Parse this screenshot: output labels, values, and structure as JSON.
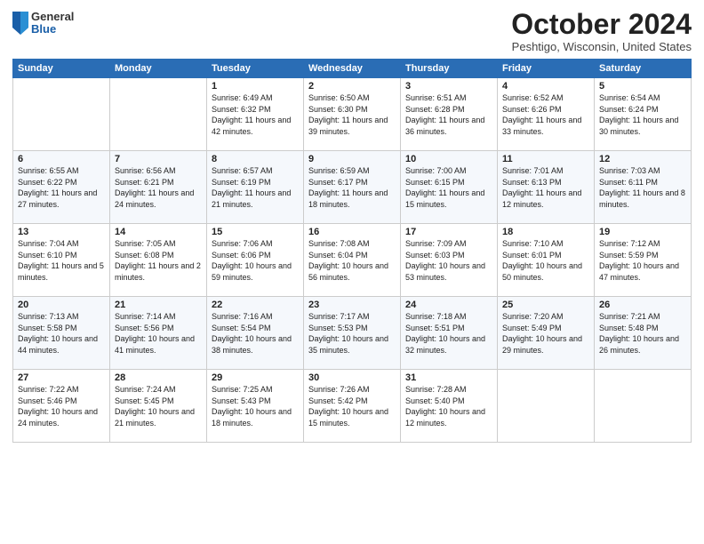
{
  "header": {
    "logo_general": "General",
    "logo_blue": "Blue",
    "month": "October 2024",
    "location": "Peshtigo, Wisconsin, United States"
  },
  "days_of_week": [
    "Sunday",
    "Monday",
    "Tuesday",
    "Wednesday",
    "Thursday",
    "Friday",
    "Saturday"
  ],
  "weeks": [
    [
      {
        "day": "",
        "info": ""
      },
      {
        "day": "",
        "info": ""
      },
      {
        "day": "1",
        "info": "Sunrise: 6:49 AM\nSunset: 6:32 PM\nDaylight: 11 hours\nand 42 minutes."
      },
      {
        "day": "2",
        "info": "Sunrise: 6:50 AM\nSunset: 6:30 PM\nDaylight: 11 hours\nand 39 minutes."
      },
      {
        "day": "3",
        "info": "Sunrise: 6:51 AM\nSunset: 6:28 PM\nDaylight: 11 hours\nand 36 minutes."
      },
      {
        "day": "4",
        "info": "Sunrise: 6:52 AM\nSunset: 6:26 PM\nDaylight: 11 hours\nand 33 minutes."
      },
      {
        "day": "5",
        "info": "Sunrise: 6:54 AM\nSunset: 6:24 PM\nDaylight: 11 hours\nand 30 minutes."
      }
    ],
    [
      {
        "day": "6",
        "info": "Sunrise: 6:55 AM\nSunset: 6:22 PM\nDaylight: 11 hours\nand 27 minutes."
      },
      {
        "day": "7",
        "info": "Sunrise: 6:56 AM\nSunset: 6:21 PM\nDaylight: 11 hours\nand 24 minutes."
      },
      {
        "day": "8",
        "info": "Sunrise: 6:57 AM\nSunset: 6:19 PM\nDaylight: 11 hours\nand 21 minutes."
      },
      {
        "day": "9",
        "info": "Sunrise: 6:59 AM\nSunset: 6:17 PM\nDaylight: 11 hours\nand 18 minutes."
      },
      {
        "day": "10",
        "info": "Sunrise: 7:00 AM\nSunset: 6:15 PM\nDaylight: 11 hours\nand 15 minutes."
      },
      {
        "day": "11",
        "info": "Sunrise: 7:01 AM\nSunset: 6:13 PM\nDaylight: 11 hours\nand 12 minutes."
      },
      {
        "day": "12",
        "info": "Sunrise: 7:03 AM\nSunset: 6:11 PM\nDaylight: 11 hours\nand 8 minutes."
      }
    ],
    [
      {
        "day": "13",
        "info": "Sunrise: 7:04 AM\nSunset: 6:10 PM\nDaylight: 11 hours\nand 5 minutes."
      },
      {
        "day": "14",
        "info": "Sunrise: 7:05 AM\nSunset: 6:08 PM\nDaylight: 11 hours\nand 2 minutes."
      },
      {
        "day": "15",
        "info": "Sunrise: 7:06 AM\nSunset: 6:06 PM\nDaylight: 10 hours\nand 59 minutes."
      },
      {
        "day": "16",
        "info": "Sunrise: 7:08 AM\nSunset: 6:04 PM\nDaylight: 10 hours\nand 56 minutes."
      },
      {
        "day": "17",
        "info": "Sunrise: 7:09 AM\nSunset: 6:03 PM\nDaylight: 10 hours\nand 53 minutes."
      },
      {
        "day": "18",
        "info": "Sunrise: 7:10 AM\nSunset: 6:01 PM\nDaylight: 10 hours\nand 50 minutes."
      },
      {
        "day": "19",
        "info": "Sunrise: 7:12 AM\nSunset: 5:59 PM\nDaylight: 10 hours\nand 47 minutes."
      }
    ],
    [
      {
        "day": "20",
        "info": "Sunrise: 7:13 AM\nSunset: 5:58 PM\nDaylight: 10 hours\nand 44 minutes."
      },
      {
        "day": "21",
        "info": "Sunrise: 7:14 AM\nSunset: 5:56 PM\nDaylight: 10 hours\nand 41 minutes."
      },
      {
        "day": "22",
        "info": "Sunrise: 7:16 AM\nSunset: 5:54 PM\nDaylight: 10 hours\nand 38 minutes."
      },
      {
        "day": "23",
        "info": "Sunrise: 7:17 AM\nSunset: 5:53 PM\nDaylight: 10 hours\nand 35 minutes."
      },
      {
        "day": "24",
        "info": "Sunrise: 7:18 AM\nSunset: 5:51 PM\nDaylight: 10 hours\nand 32 minutes."
      },
      {
        "day": "25",
        "info": "Sunrise: 7:20 AM\nSunset: 5:49 PM\nDaylight: 10 hours\nand 29 minutes."
      },
      {
        "day": "26",
        "info": "Sunrise: 7:21 AM\nSunset: 5:48 PM\nDaylight: 10 hours\nand 26 minutes."
      }
    ],
    [
      {
        "day": "27",
        "info": "Sunrise: 7:22 AM\nSunset: 5:46 PM\nDaylight: 10 hours\nand 24 minutes."
      },
      {
        "day": "28",
        "info": "Sunrise: 7:24 AM\nSunset: 5:45 PM\nDaylight: 10 hours\nand 21 minutes."
      },
      {
        "day": "29",
        "info": "Sunrise: 7:25 AM\nSunset: 5:43 PM\nDaylight: 10 hours\nand 18 minutes."
      },
      {
        "day": "30",
        "info": "Sunrise: 7:26 AM\nSunset: 5:42 PM\nDaylight: 10 hours\nand 15 minutes."
      },
      {
        "day": "31",
        "info": "Sunrise: 7:28 AM\nSunset: 5:40 PM\nDaylight: 10 hours\nand 12 minutes."
      },
      {
        "day": "",
        "info": ""
      },
      {
        "day": "",
        "info": ""
      }
    ]
  ]
}
